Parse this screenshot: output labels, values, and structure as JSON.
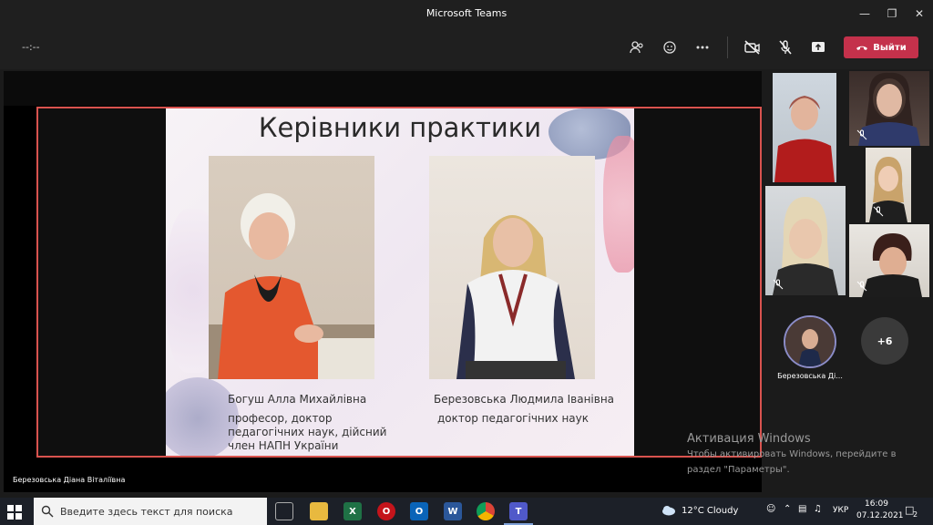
{
  "window": {
    "title": "Microsoft Teams"
  },
  "toolbar": {
    "timer": "--:--",
    "leave_label": "Выйти"
  },
  "slide": {
    "title": "Керівники практики",
    "person1": {
      "name": "Богуш Алла Михайлівна",
      "role": "професор, доктор педагогічних наук, дійсний член НАПН України"
    },
    "person2": {
      "name": "Березовська Людмила Іванівна",
      "role": "доктор педагогічних наук"
    }
  },
  "presenter": {
    "name": "Березовська Діана Віталіївна"
  },
  "participants": {
    "overflow_count": "+6",
    "self_name": "Березовська Ді..."
  },
  "watermark": {
    "line1": "Активация Windows",
    "line2": "Чтобы активировать Windows, перейдите в",
    "line3": "раздел \"Параметры\"."
  },
  "taskbar": {
    "search_placeholder": "Введите здесь текст для поиска",
    "weather": "12°C  Cloudy",
    "lang": "УКР",
    "time": "16:09",
    "date": "07.12.2021",
    "notifications": "2"
  },
  "colors": {
    "leave": "#c4314b",
    "share_border": "#d9534f",
    "avatar_ring": "#8b8cc7"
  }
}
